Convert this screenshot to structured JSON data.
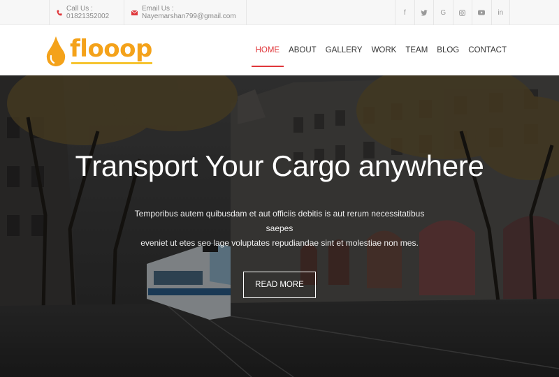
{
  "topbar": {
    "phone_text": "Call Us : 01821352002",
    "email_text": "Email Us : Nayemarshan799@gmail.com",
    "social_icons": [
      "facebook-icon",
      "twitter-icon",
      "google-icon",
      "instagram-icon",
      "youtube-icon",
      "linkedin-icon"
    ],
    "social_glyphs": [
      "f",
      "🐦",
      "G",
      "◎",
      "▶",
      "in"
    ]
  },
  "header": {
    "logo_text": "flooop",
    "nav": [
      "HOME",
      "ABOUT",
      "GALLERY",
      "WORK",
      "TEAM",
      "BLOG",
      "CONTACT"
    ],
    "active": "HOME"
  },
  "hero": {
    "title": "Transport Your Cargo anywhere",
    "text_line1": "Temporibus autem quibusdam et aut officiis debitis is aut rerum necessitatibus saepes",
    "text_line2": "eveniet ut etes seo lage voluptates repudiandae sint et molestiae non mes.",
    "button_label": "READ MORE"
  },
  "colors": {
    "accent": "#e0373b",
    "brand": "#f4a21a",
    "brand_underline": "#f6c431"
  }
}
